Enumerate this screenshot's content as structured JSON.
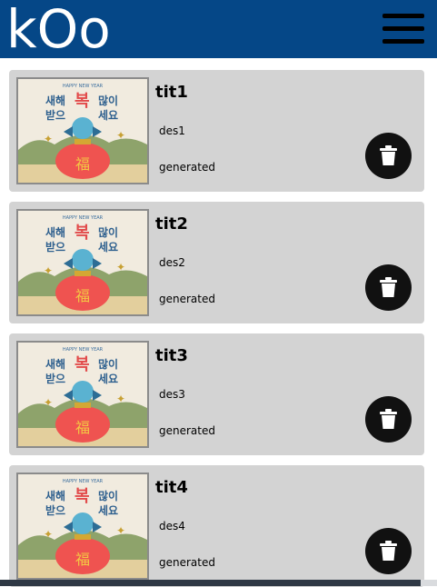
{
  "app": {
    "logo_text": "kOo"
  },
  "icons": {
    "menu": "hamburger-menu-icon",
    "delete": "trash-icon"
  },
  "colors": {
    "header": "#054787",
    "card": "#d3d3d3",
    "button": "#111111"
  },
  "thumbnail": {
    "header_text": "HAPPY NEW YEAR",
    "line1": "새해 복 많이",
    "line2": "받으 세요",
    "bag_text": "福"
  },
  "items": [
    {
      "title": "tit1",
      "description": "des1",
      "status": "generated"
    },
    {
      "title": "tit2",
      "description": "des2",
      "status": "generated"
    },
    {
      "title": "tit3",
      "description": "des3",
      "status": "generated"
    },
    {
      "title": "tit4",
      "description": "des4",
      "status": "generated"
    }
  ]
}
